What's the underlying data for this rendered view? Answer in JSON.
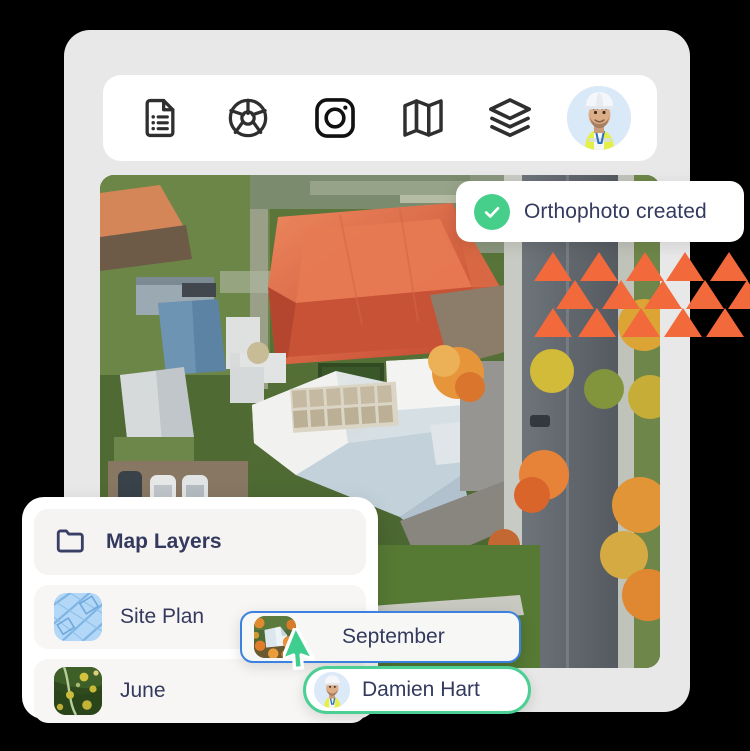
{
  "app": {
    "card_bg": "#e8e8e8"
  },
  "toolbar": {
    "items": [
      {
        "icon": "document-list-icon",
        "label": "Reports"
      },
      {
        "icon": "aperture-icon",
        "label": "Captures"
      },
      {
        "icon": "camera-icon",
        "label": "Photos"
      },
      {
        "icon": "map-icon",
        "label": "Map"
      },
      {
        "icon": "layers-icon",
        "label": "Layers"
      }
    ],
    "avatar": {
      "icon": "user-avatar",
      "label": "Damien Hart"
    }
  },
  "toast": {
    "icon": "check-circle-icon",
    "message": "Orthophoto created",
    "accent": "#46cf8b"
  },
  "overlay": {
    "marker_color": "#f2693c",
    "marker_count": 16,
    "marker_shape": "triangle"
  },
  "layers_panel": {
    "header": {
      "icon": "folder-icon",
      "title": "Map Layers"
    },
    "rows": [
      {
        "thumb": "site-plan-thumbnail",
        "label": "Site Plan"
      },
      {
        "thumb": "june-aerial-thumbnail",
        "label": "June"
      }
    ]
  },
  "september_chip": {
    "thumb": "september-aerial-thumbnail",
    "label": "September",
    "border_color": "#3b82e0"
  },
  "cursor": {
    "icon": "pointer-cursor",
    "color": "#3ecf8e"
  },
  "user_pill": {
    "avatar": "user-avatar",
    "name": "Damien Hart",
    "border_color": "#4bcf93"
  }
}
